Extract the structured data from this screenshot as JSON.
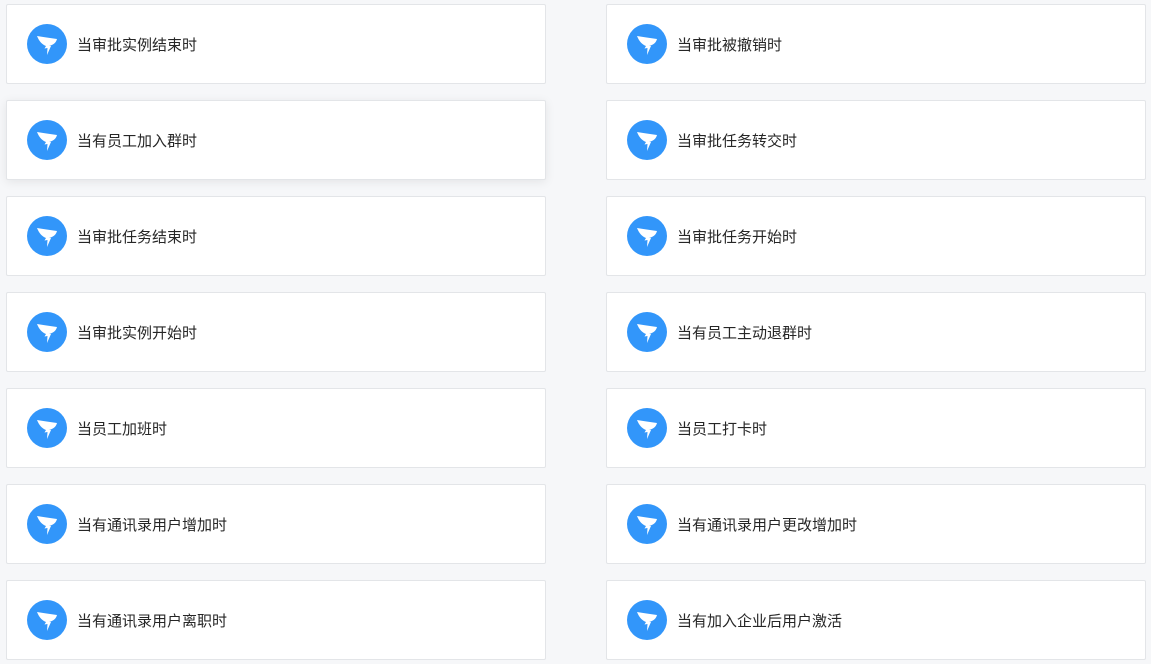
{
  "theme": {
    "brand_color": "#3296fa",
    "card_background": "#ffffff",
    "page_background": "#f6f7f9",
    "text_color": "#262626"
  },
  "triggers": [
    {
      "label": "当审批实例结束时",
      "icon": "dingtalk-logo-icon"
    },
    {
      "label": "当审批被撤销时",
      "icon": "dingtalk-logo-icon"
    },
    {
      "label": "当有员工加入群时",
      "icon": "dingtalk-logo-icon"
    },
    {
      "label": "当审批任务转交时",
      "icon": "dingtalk-logo-icon"
    },
    {
      "label": "当审批任务结束时",
      "icon": "dingtalk-logo-icon"
    },
    {
      "label": "当审批任务开始时",
      "icon": "dingtalk-logo-icon"
    },
    {
      "label": "当审批实例开始时",
      "icon": "dingtalk-logo-icon"
    },
    {
      "label": "当有员工主动退群时",
      "icon": "dingtalk-logo-icon"
    },
    {
      "label": "当员工加班时",
      "icon": "dingtalk-logo-icon"
    },
    {
      "label": "当员工打卡时",
      "icon": "dingtalk-logo-icon"
    },
    {
      "label": "当有通讯录用户增加时",
      "icon": "dingtalk-logo-icon"
    },
    {
      "label": "当有通讯录用户更改增加时",
      "icon": "dingtalk-logo-icon"
    },
    {
      "label": "当有通讯录用户离职时",
      "icon": "dingtalk-logo-icon"
    },
    {
      "label": "当有加入企业后用户激活",
      "icon": "dingtalk-logo-icon"
    }
  ]
}
